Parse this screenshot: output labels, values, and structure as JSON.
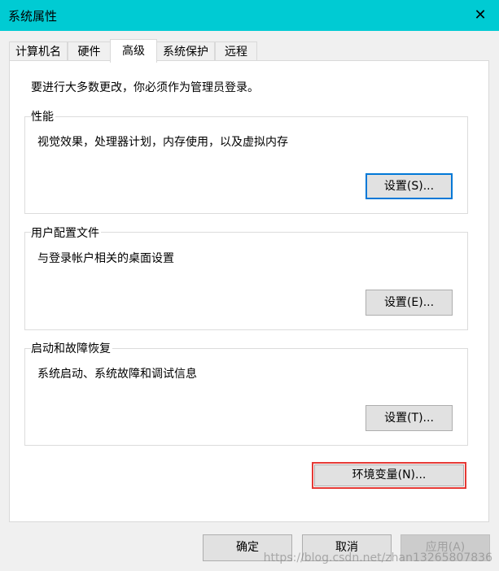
{
  "window": {
    "title": "系统属性",
    "close_glyph": "✕"
  },
  "tabs": [
    {
      "label": "计算机名"
    },
    {
      "label": "硬件"
    },
    {
      "label": "高级",
      "active": true
    },
    {
      "label": "系统保护"
    },
    {
      "label": "远程"
    }
  ],
  "admin_note": "要进行大多数更改，你必须作为管理员登录。",
  "performance": {
    "label": "性能",
    "description": "视觉效果，处理器计划，内存使用，以及虚拟内存",
    "button": "设置(S)..."
  },
  "user_profiles": {
    "label": "用户配置文件",
    "description": "与登录帐户相关的桌面设置",
    "button": "设置(E)..."
  },
  "startup_recovery": {
    "label": "启动和故障恢复",
    "description": "系统启动、系统故障和调试信息",
    "button": "设置(T)..."
  },
  "env_vars_button": "环境变量(N)...",
  "footer": {
    "ok": "确定",
    "cancel": "取消",
    "apply": "应用(A)"
  },
  "watermark": "https://blog.csdn.net/zhan13265807836",
  "colors": {
    "titlebar": "#00cbd3",
    "focus": "#0078d7",
    "highlight": "#e53935"
  }
}
